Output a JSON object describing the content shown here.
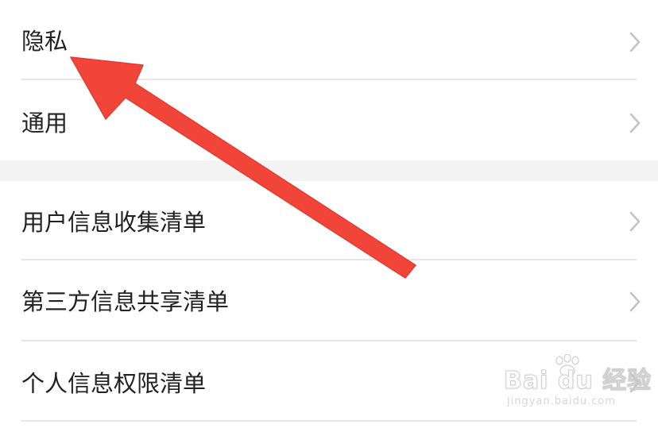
{
  "settings": {
    "section_1": [
      {
        "label": "隐私"
      },
      {
        "label": "通用"
      }
    ],
    "section_2": [
      {
        "label": "用户信息收集清单"
      },
      {
        "label": "第三方信息共享清单"
      },
      {
        "label": "个人信息权限清单"
      }
    ]
  },
  "watermark": {
    "brand": "Bai du 经验",
    "url": "jingyan.baidu.com"
  },
  "colors": {
    "arrow": "#f2453a",
    "text": "#222222",
    "chevron": "#c4c4c4",
    "divider": "#e6e6e6",
    "section_gap": "#f3f3f3"
  },
  "icons": {
    "row_disclosure": "chevron-right-icon",
    "annotation": "red-arrow-icon",
    "watermark_logo": "paw-icon"
  }
}
